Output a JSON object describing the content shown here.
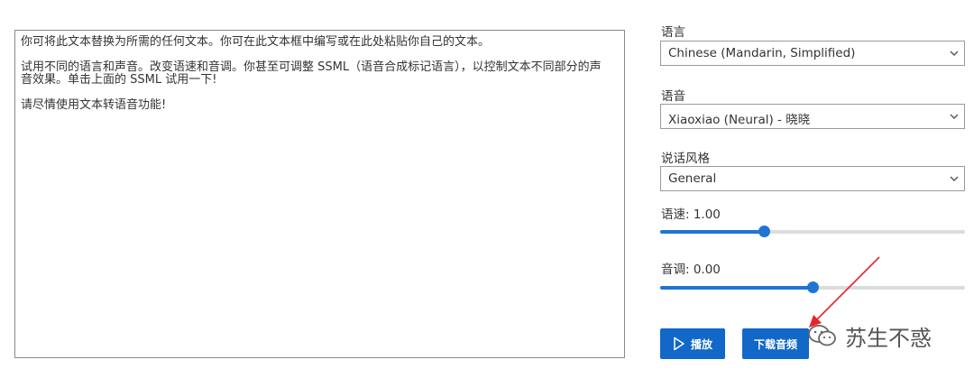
{
  "textarea": {
    "text": "你可将此文本替换为所需的任何文本。你可在此文本框中编写或在此处粘贴你自己的文本。\n\n试用不同的语言和声音。改变语速和音调。你甚至可调整 SSML（语音合成标记语言），以控制文本不同部分的声\n音效果。单击上面的 SSML 试用一下!\n\n请尽情使用文本转语音功能!"
  },
  "language": {
    "label": "语言",
    "value": "Chinese (Mandarin, Simplified)"
  },
  "voice": {
    "label": "语音",
    "value": "Xiaoxiao (Neural) - 晓晓"
  },
  "style": {
    "label": "说话风格",
    "value": "General"
  },
  "rate": {
    "label": "语速: 1.00",
    "fraction": 0.34
  },
  "pitch": {
    "label": "音调: 0.00",
    "fraction": 0.5
  },
  "buttons": {
    "play": "播放",
    "download": "下载音频"
  },
  "watermark": {
    "text": "苏生不惑"
  },
  "colors": {
    "accent": "#1168c8",
    "slider": "#1f74d4",
    "arrow": "#e8252a"
  },
  "icons": {
    "play": "play-icon",
    "chevron": "chevron-down-icon",
    "watermark": "wechat-icon"
  }
}
